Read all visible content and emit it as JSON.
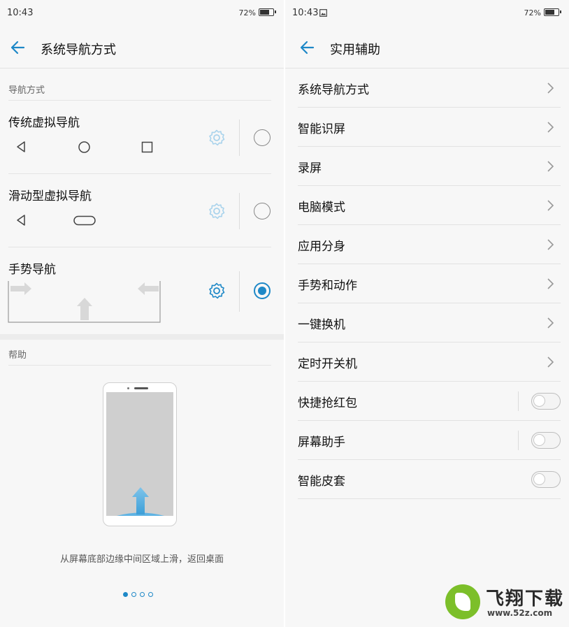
{
  "left_screen": {
    "status": {
      "time": "10:43",
      "battery": "72%"
    },
    "title": "系统导航方式",
    "section_nav": "导航方式",
    "options": [
      {
        "label": "传统虚拟导航",
        "selected": false
      },
      {
        "label": "滑动型虚拟导航",
        "selected": false
      },
      {
        "label": "手势导航",
        "selected": true
      }
    ],
    "section_help": "帮助",
    "help_text": "从屏幕底部边缘中间区域上滑，返回桌面",
    "pager": {
      "pages": 4,
      "current": 1
    }
  },
  "right_screen": {
    "status": {
      "time": "10:43",
      "battery": "72%"
    },
    "title": "实用辅助",
    "items": [
      {
        "label": "系统导航方式",
        "control": "chevron"
      },
      {
        "label": "智能识屏",
        "control": "chevron"
      },
      {
        "label": "录屏",
        "control": "chevron"
      },
      {
        "label": "电脑模式",
        "control": "chevron"
      },
      {
        "label": "应用分身",
        "control": "chevron"
      },
      {
        "label": "手势和动作",
        "control": "chevron"
      },
      {
        "label": "一键换机",
        "control": "chevron"
      },
      {
        "label": "定时开关机",
        "control": "chevron"
      },
      {
        "label": "快捷抢红包",
        "control": "toggle",
        "on": false
      },
      {
        "label": "屏幕助手",
        "control": "toggle",
        "on": false
      },
      {
        "label": "智能皮套",
        "control": "toggle",
        "on": false
      }
    ]
  },
  "watermark": {
    "brand": "飞翔下载",
    "url": "www.52z.com"
  },
  "colors": {
    "accent": "#1e88c7",
    "gear_inactive": "#a9d3ec"
  }
}
